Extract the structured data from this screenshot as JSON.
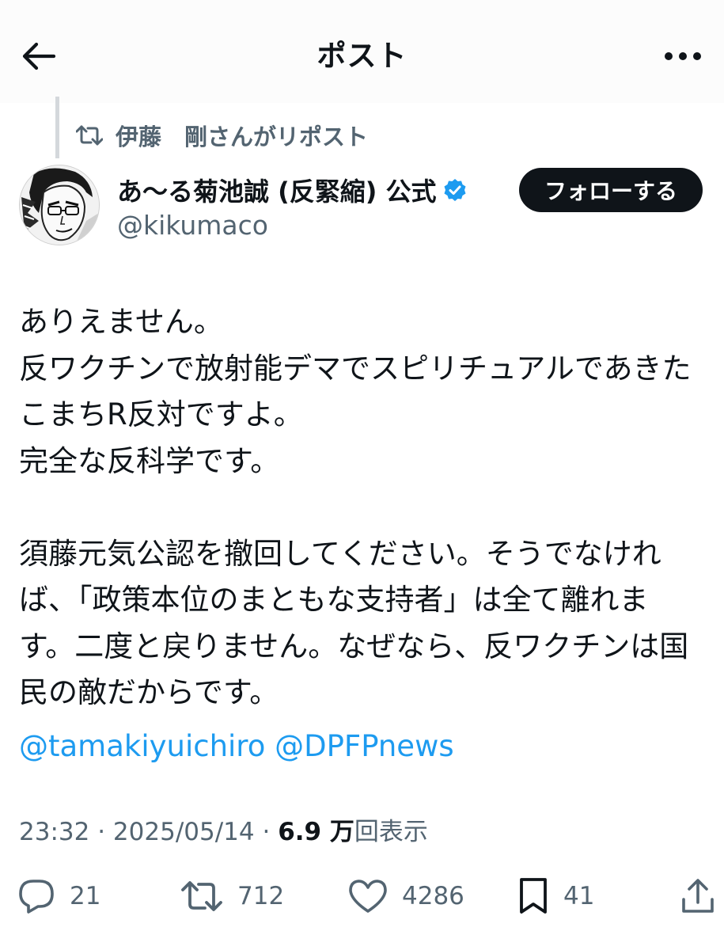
{
  "header": {
    "title": "ポスト"
  },
  "repost": {
    "text": "伊藤　剛さんがリポスト"
  },
  "author": {
    "name": "あ〜る菊池誠 (反緊縮) 公式",
    "handle": "@kikumaco",
    "verified_color": "#1d9bf0"
  },
  "follow_button": {
    "label": "フォローする"
  },
  "post": {
    "lines": [
      "ありえません。",
      "反ワクチンで放射能デマでスピリチュアルであきた",
      "こまちR反対ですよ。",
      "完全な反科学です。",
      "",
      "須藤元気公認を撤回してください。そうでなけれ",
      "ば、「政策本位のまともな支持者」は全て離れま",
      "す。二度と戻りません。なぜなら、反ワクチンは国",
      "民の敵だからです。"
    ],
    "mentions": [
      "@tamakiyuichiro",
      "@DPFPnews"
    ]
  },
  "meta": {
    "time": "23:32",
    "date": "2025/05/14",
    "views_count": "6.9 万",
    "views_label": "回表示",
    "separator": "·"
  },
  "stats": {
    "replies": "21",
    "reposts": "712",
    "likes": "4286",
    "bookmarks": "41"
  },
  "colors": {
    "accent": "#1d9bf0",
    "text": "#0f1419",
    "secondary": "#536471"
  }
}
